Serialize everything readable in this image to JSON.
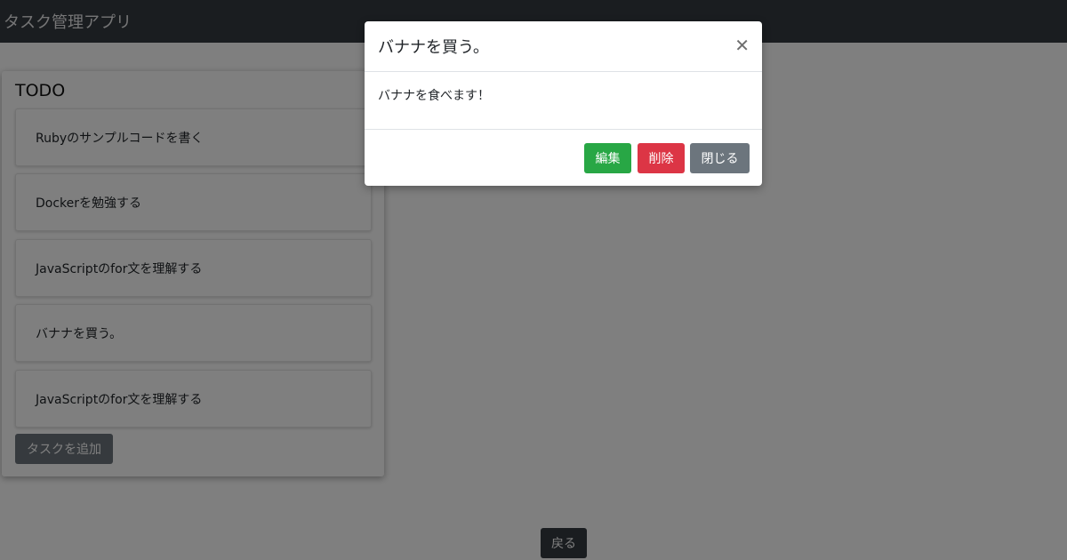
{
  "navbar": {
    "brand": "タスク管理アプリ"
  },
  "todo": {
    "heading": "TODO",
    "tasks": [
      "Rubyのサンプルコードを書く",
      "Dockerを勉強する",
      "JavaScriptのfor文を理解する",
      "バナナを買う。",
      "JavaScriptのfor文を理解する"
    ],
    "add_label": "タスクを追加"
  },
  "back_label": "戻る",
  "modal": {
    "title": "バナナを買う。",
    "close_icon": "close-icon",
    "body": "バナナを食べます！",
    "edit_label": "編集",
    "delete_label": "削除",
    "close_label": "閉じる"
  },
  "colors": {
    "navbar": "#343a40",
    "edit": "#28a745",
    "delete": "#dc3545",
    "secondary": "#6c757d",
    "dark": "#343a40"
  }
}
